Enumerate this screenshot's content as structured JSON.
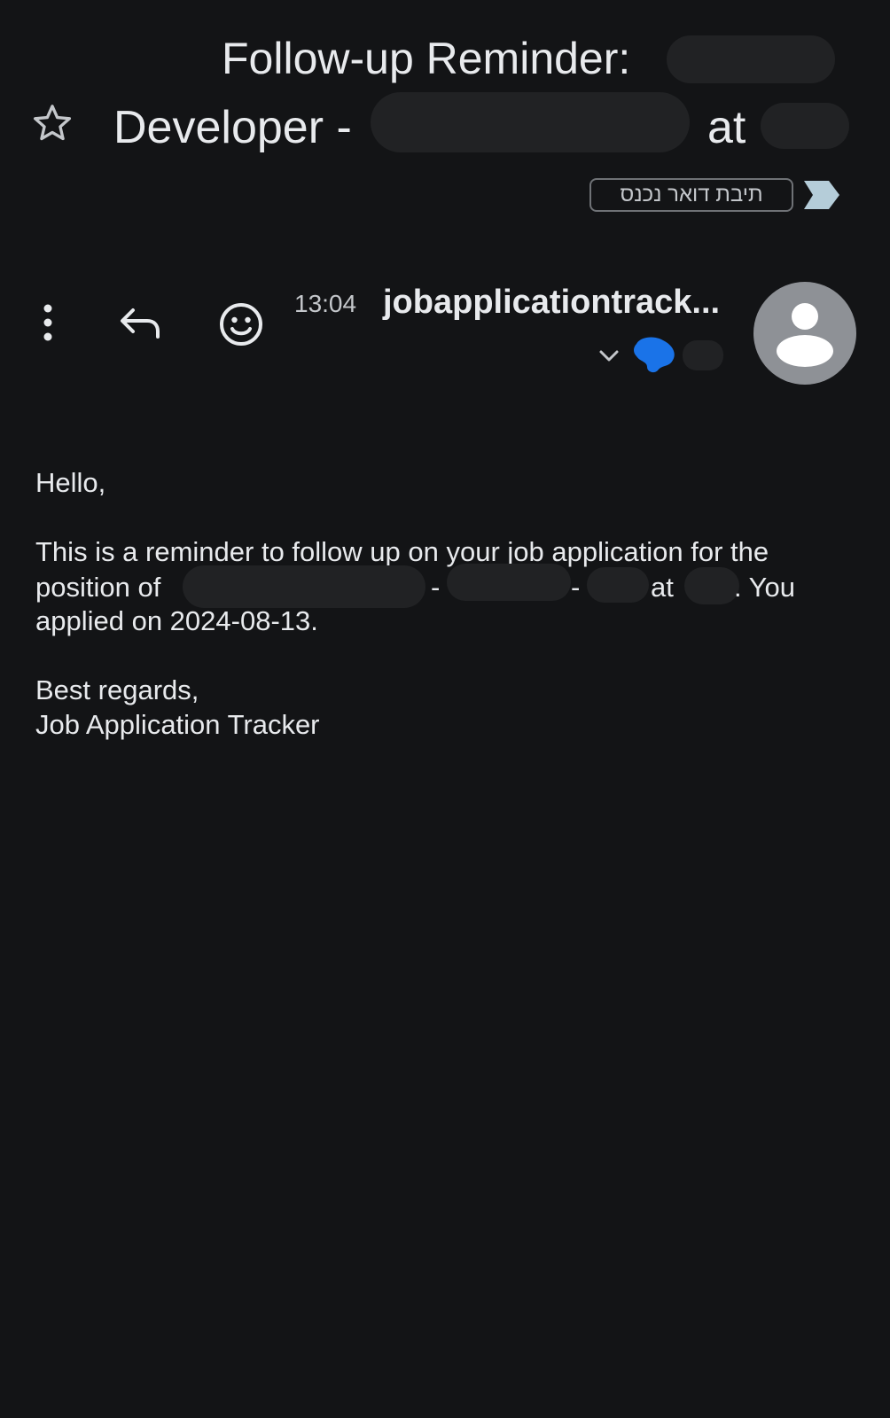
{
  "subject": {
    "line1": "Follow-up Reminder:",
    "line2": "Developer -",
    "at": "at"
  },
  "label_chip": "תיבת דואר נכנס",
  "message": {
    "time": "13:04",
    "sender": "jobapplicationtrack..."
  },
  "body": {
    "greeting": "Hello,",
    "line1": "This is a reminder to follow up on your job application for the",
    "position_of": "position of",
    "dash1": "-",
    "dash2": "-",
    "at": "at",
    "you": ". You",
    "applied": "applied on 2024-08-13.",
    "regards": "Best regards,",
    "signature": "Job Application Tracker"
  },
  "colors": {
    "background": "#131416",
    "text": "#e8eaed",
    "importance_marker": "#b5cdd9",
    "avatar": "#8e9196",
    "redaction_blue": "#1a73e8"
  },
  "icons": [
    "star-icon",
    "importance-marker-icon",
    "more-vert-icon",
    "reply-icon",
    "emoji-reaction-icon",
    "chevron-down-icon",
    "person-icon"
  ]
}
